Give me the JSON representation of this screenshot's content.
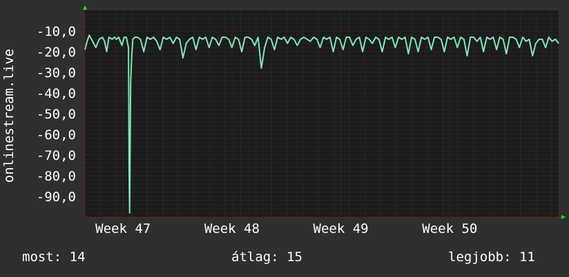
{
  "chart_data": {
    "type": "line",
    "ylabel": "onlinestream.live",
    "ylim": [
      -100,
      0
    ],
    "y_ticks": [
      -10,
      -20,
      -30,
      -40,
      -50,
      -60,
      -70,
      -80,
      -90
    ],
    "y_tick_labels": [
      "-10,0",
      "-20,0",
      "-30,0",
      "-40,0",
      "-50,0",
      "-60,0",
      "-70,0",
      "-80,0",
      "-90,0"
    ],
    "xlim": [
      0,
      4.35
    ],
    "x_ticks": [
      0.35,
      1.35,
      2.35,
      3.35
    ],
    "x_tick_labels": [
      "Week 47",
      "Week 48",
      "Week 49",
      "Week 50"
    ],
    "grid": true,
    "series": [
      {
        "color": "#7fe7b8",
        "x": [
          0.0,
          0.02,
          0.04,
          0.06,
          0.08,
          0.1,
          0.13,
          0.16,
          0.18,
          0.2,
          0.22,
          0.25,
          0.27,
          0.29,
          0.31,
          0.34,
          0.36,
          0.38,
          0.4,
          0.405,
          0.41,
          0.42,
          0.43,
          0.44,
          0.46,
          0.48,
          0.51,
          0.54,
          0.57,
          0.6,
          0.63,
          0.66,
          0.69,
          0.72,
          0.75,
          0.78,
          0.81,
          0.84,
          0.87,
          0.9,
          0.93,
          0.96,
          0.99,
          1.02,
          1.05,
          1.08,
          1.11,
          1.14,
          1.17,
          1.2,
          1.23,
          1.26,
          1.29,
          1.32,
          1.35,
          1.38,
          1.41,
          1.44,
          1.47,
          1.5,
          1.53,
          1.56,
          1.59,
          1.62,
          1.65,
          1.68,
          1.71,
          1.74,
          1.77,
          1.8,
          1.83,
          1.86,
          1.89,
          1.92,
          1.95,
          1.98,
          2.01,
          2.04,
          2.07,
          2.1,
          2.13,
          2.16,
          2.19,
          2.22,
          2.25,
          2.28,
          2.31,
          2.34,
          2.37,
          2.4,
          2.43,
          2.46,
          2.49,
          2.52,
          2.55,
          2.58,
          2.61,
          2.64,
          2.67,
          2.7,
          2.73,
          2.76,
          2.79,
          2.82,
          2.85,
          2.88,
          2.91,
          2.94,
          2.97,
          3.0,
          3.03,
          3.06,
          3.09,
          3.12,
          3.15,
          3.18,
          3.21,
          3.24,
          3.27,
          3.3,
          3.33,
          3.36,
          3.39,
          3.42,
          3.45,
          3.48,
          3.51,
          3.54,
          3.57,
          3.6,
          3.63,
          3.66,
          3.69,
          3.72,
          3.75,
          3.78,
          3.81,
          3.84,
          3.87,
          3.9,
          3.93,
          3.96,
          3.99,
          4.02,
          4.05,
          4.08,
          4.11,
          4.14,
          4.17,
          4.2,
          4.23,
          4.26,
          4.29,
          4.32,
          4.35
        ],
        "values": [
          -19,
          -15,
          -12,
          -14,
          -16,
          -18,
          -14,
          -13,
          -15,
          -20,
          -13,
          -14,
          -13,
          -14,
          -13,
          -17,
          -13,
          -13,
          -18,
          -75,
          -98,
          -35,
          -22,
          -14,
          -13,
          -13,
          -14,
          -20,
          -13,
          -14,
          -13,
          -15,
          -19,
          -13,
          -14,
          -13,
          -16,
          -13,
          -14,
          -23,
          -16,
          -14,
          -13,
          -19,
          -13,
          -14,
          -13,
          -18,
          -13,
          -14,
          -17,
          -13,
          -13,
          -14,
          -18,
          -13,
          -14,
          -20,
          -13,
          -13,
          -14,
          -17,
          -13,
          -28,
          -18,
          -13,
          -14,
          -19,
          -13,
          -14,
          -13,
          -16,
          -13,
          -14,
          -17,
          -14,
          -13,
          -14,
          -15,
          -13,
          -14,
          -18,
          -13,
          -14,
          -13,
          -20,
          -13,
          -14,
          -19,
          -13,
          -13,
          -17,
          -14,
          -13,
          -20,
          -13,
          -14,
          -16,
          -13,
          -14,
          -20,
          -13,
          -14,
          -13,
          -18,
          -13,
          -14,
          -13,
          -21,
          -13,
          -14,
          -20,
          -13,
          -14,
          -13,
          -19,
          -13,
          -13,
          -14,
          -20,
          -13,
          -14,
          -13,
          -18,
          -13,
          -14,
          -22,
          -13,
          -13,
          -15,
          -13,
          -20,
          -13,
          -14,
          -13,
          -19,
          -13,
          -14,
          -21,
          -13,
          -13,
          -14,
          -18,
          -13,
          -15,
          -14,
          -22,
          -16,
          -14,
          -14,
          -18,
          -13,
          -15,
          -14,
          -16
        ]
      }
    ]
  },
  "stats": {
    "current": "most: 14",
    "average": "átlag: 15",
    "best": "legjobb: 11"
  }
}
